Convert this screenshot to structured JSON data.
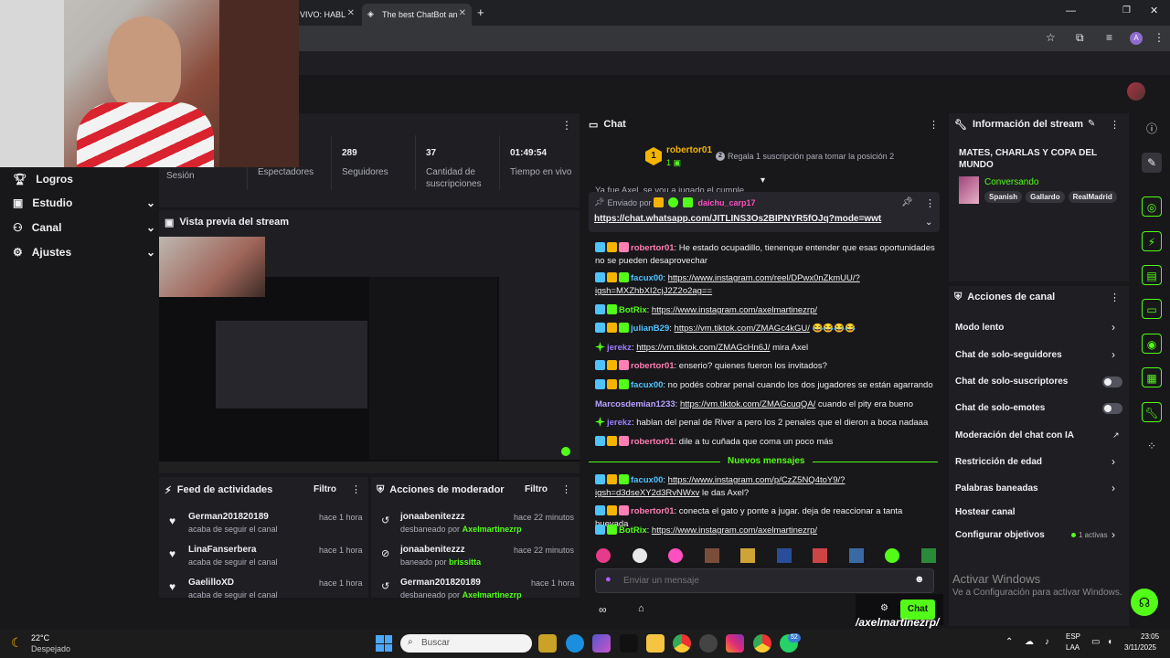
{
  "browser": {
    "tabs": [
      {
        "label": "VIVO: HABL"
      },
      {
        "label": "The best ChatBot an"
      }
    ],
    "new_tab": "+",
    "profile_initial": "A"
  },
  "nav": {
    "items": [
      {
        "label": "Logros"
      },
      {
        "label": "Estudio"
      },
      {
        "label": "Canal"
      },
      {
        "label": "Ajustes"
      }
    ]
  },
  "stats": {
    "items": [
      {
        "label": "Sesión",
        "value": ""
      },
      {
        "label": "Espectadores",
        "value": ""
      },
      {
        "label": "Seguidores",
        "value": "289"
      },
      {
        "label": "Cantidad de suscripciones",
        "value": "37"
      },
      {
        "label": "Tiempo en vivo",
        "value": "01:49:54"
      }
    ]
  },
  "preview": {
    "title": "Vista previa del stream"
  },
  "feed": {
    "title": "Feed de actividades",
    "filter": "Filtro",
    "rows": [
      {
        "name": "German201820189",
        "sub": "acaba de seguir el canal",
        "time": "hace 1 hora"
      },
      {
        "name": "LinaFanserbera",
        "sub": "acaba de seguir el canal",
        "time": "hace 1 hora"
      },
      {
        "name": "GaelilloXD",
        "sub": "acaba de seguir el canal",
        "time": "hace 1 hora"
      }
    ]
  },
  "mod": {
    "title": "Acciones de moderador",
    "filter": "Filtro",
    "rows": [
      {
        "name": "jonaabenitezzz",
        "action": "desbaneado por",
        "by": "Axelmartinezrp",
        "time": "hace 22 minutos"
      },
      {
        "name": "jonaabenitezzz",
        "action": "baneado por",
        "by": "brissitta",
        "time": "hace 22 minutos"
      },
      {
        "name": "German201820189",
        "action": "desbaneado por",
        "by": "Axelmartinezrp",
        "time": "hace 1 hora"
      }
    ]
  },
  "chat": {
    "title": "Chat",
    "top_gifter": {
      "rank": "1",
      "name": "robertor01",
      "count": "1",
      "gift_count": "2",
      "gift_text": "Regala 1 suscripción para tomar la posición 2"
    },
    "pinned": {
      "prefix": "Enviado por",
      "user": "daichu_carp17",
      "link": "https://chat.whatsapp.com/JITLINS3Os2BIPNYR5fOJq?mode=wwt"
    },
    "partial": "Ya fue Axel, se vou a jugado el cumple",
    "messages": [
      {
        "user": "robertor01",
        "text": "He estado ocupadillo, tienenque entender que esas oportunidades no se pueden desaprovechar",
        "link": "",
        "color": "#ff7eb6"
      },
      {
        "user": "facux00",
        "text": "",
        "link": "https://www.instagram.com/reel/DPwx0nZkmUU/?igsh=MXZhbXI2cjJ2Z2o2ag==",
        "color": "#4ec3ff"
      },
      {
        "user": "BotRix",
        "text": "",
        "link": "https://www.instagram.com/axelmartinezrp/",
        "color": "#53fc18"
      },
      {
        "user": "julianB29",
        "text": " 😂😂😂😂",
        "link": "https://vm.tiktok.com/ZMAGc4kGU/",
        "color": "#4ec3ff"
      },
      {
        "user": "jerekz",
        "text": " mira Axel",
        "link": "https://vm.tiktok.com/ZMAGcHn6J/",
        "color": "#9b7cff"
      },
      {
        "user": "robertor01",
        "text": "enserio? quienes fueron los invitados?",
        "link": "",
        "color": "#ff7eb6"
      },
      {
        "user": "facux00",
        "text": "no podés cobrar penal cuando los dos jugadores se están agarrando",
        "link": "",
        "color": "#4ec3ff"
      },
      {
        "user": "Marcosdemian1233",
        "text": " cuando el pity era bueno",
        "link": "https://vm.tiktok.com/ZMAGcuqQA/",
        "color": "#b9a3ff"
      },
      {
        "user": "jerekz",
        "text": "hablan del penal de River a pero los 2 penales que el dieron a boca nadaaa",
        "link": "",
        "color": "#9b7cff"
      },
      {
        "user": "robertor01",
        "text": "dile a tu cuñada que coma un poco más",
        "link": "",
        "color": "#ff7eb6"
      }
    ],
    "new_label": "Nuevos mensajes",
    "new_messages": [
      {
        "user": "facux00",
        "text": " le das Axel?",
        "link": "https://www.instagram.com/p/CzZ5NQ4toY9/?igsh=d3dseXY2d3RvNWxv",
        "color": "#4ec3ff"
      },
      {
        "user": "robertor01",
        "text": "conecta el gato y ponte a jugar. deja de reaccionar a tanta huevada",
        "link": "",
        "color": "#ff7eb6"
      },
      {
        "user": "BotRix",
        "text": "",
        "link": "https://www.instagram.com/axelmartinezrp/",
        "color": "#53fc18"
      }
    ],
    "input_placeholder": "Enviar un mensaje",
    "send_label": "Chat",
    "watermark": "/axelmartinezrp/"
  },
  "info": {
    "title": "Información del stream",
    "stream_title": "MATES, CHARLAS Y COPA DEL MUNDO",
    "category": "Conversando",
    "tags": [
      "Spanish",
      "Gallardo",
      "RealMadrid"
    ]
  },
  "acciones": {
    "title": "Acciones de canal",
    "items": [
      {
        "label": "Modo lento",
        "kind": "arrow"
      },
      {
        "label": "Chat de solo-seguidores",
        "kind": "arrow"
      },
      {
        "label": "Chat de solo-suscriptores",
        "kind": "toggle"
      },
      {
        "label": "Chat de solo-emotes",
        "kind": "toggle"
      },
      {
        "label": "Moderación del chat con IA",
        "kind": "external"
      },
      {
        "label": "Restricción de edad",
        "kind": "arrow"
      },
      {
        "label": "Palabras baneadas",
        "kind": "arrow"
      },
      {
        "label": "Hostear canal",
        "kind": "none"
      },
      {
        "label": "Configurar objetivos",
        "kind": "arrow",
        "extra": "1 activas"
      }
    ]
  },
  "windows_activation": {
    "title": "Activar Windows",
    "sub": "Ve a Configuración para activar Windows."
  },
  "taskbar": {
    "weather_temp": "22°C",
    "weather_desc": "Despejado",
    "search": "Buscar",
    "lang1": "ESP",
    "lang2": "LAA",
    "time": "23:05",
    "date": "3/11/2025",
    "badge": "52"
  },
  "colors": {
    "accent": "#53fc18",
    "panel": "#1f1f23",
    "bg": "#18181b"
  }
}
